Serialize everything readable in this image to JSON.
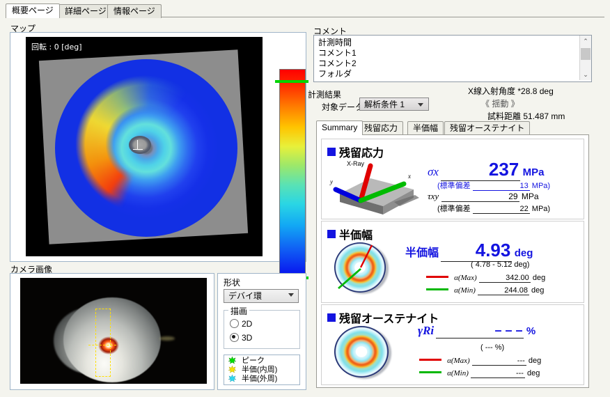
{
  "window": {
    "bg": "#f4f4ee"
  },
  "tabs": [
    {
      "label": "概要ページ",
      "selected": true
    },
    {
      "label": "詳細ページ",
      "selected": false
    },
    {
      "label": "情報ページ",
      "selected": false
    }
  ],
  "map": {
    "group_label": "マップ",
    "rotation_text": "回転 : 0 [deg]",
    "colorbar": {
      "top_color": "#ff0000",
      "bottom_color": "#0000ee",
      "marker_color": "#00d400"
    }
  },
  "camera": {
    "group_label": "カメラ画像",
    "selection_color": "#ffe000"
  },
  "shape": {
    "group_label": "形状",
    "selected_shape": "デバイ環",
    "draw_legend": "描画",
    "draw_options": [
      {
        "label": "2D",
        "selected": false
      },
      {
        "label": "3D",
        "selected": true
      }
    ],
    "legend": [
      {
        "label": "ピーク",
        "color": "#00e000"
      },
      {
        "label": "半価(内周)",
        "color": "#f5e400"
      },
      {
        "label": "半価(外周)",
        "color": "#30d8f0"
      }
    ]
  },
  "comment": {
    "group_label": "コメント",
    "items": [
      "計測時間",
      "コメント1",
      "コメント2",
      "フォルダ"
    ],
    "scroll_up": "⌃",
    "scroll_down": "⌄"
  },
  "measurement": {
    "group_label": "計測結果",
    "target_data_label": "対象データ",
    "target_data_value": "解析条件 1",
    "xray_angle_label": "X線入射角度",
    "xray_angle_value": "*28.8 deg",
    "swing_label": "《 揺動 》",
    "distance_label": "試料距離",
    "distance_value": "51.487 mm"
  },
  "result_tabs": [
    {
      "label": "Summary",
      "selected": true
    },
    {
      "label": "残留応力",
      "selected": false
    },
    {
      "label": "半価幅",
      "selected": false
    },
    {
      "label": "残留オーステナイト",
      "selected": false
    }
  ],
  "stress_card": {
    "title": "残留応力",
    "sketch_labels": {
      "xray": "X-Ray",
      "x_axis": "x",
      "y_axis": "y"
    },
    "sigma_symbol": "σx",
    "sigma_value": "237",
    "sigma_unit": "MPa",
    "sigma_sd_label": "(標準偏差",
    "sigma_sd_value": "13",
    "sigma_sd_unit": "MPa)",
    "tau_symbol": "τxy",
    "tau_value": "29",
    "tau_unit": "MPa",
    "tau_sd_label": "(標準偏差",
    "tau_sd_value": "22",
    "tau_sd_unit": "MPa)"
  },
  "fwhm_card": {
    "title": "半価幅",
    "value_label": "半価幅",
    "value": "4.93",
    "unit": "deg",
    "range_text": "( 4.78 - 5.12 deg)",
    "alpha_max_label": "α(Max)",
    "alpha_max_value": "342.00",
    "alpha_max_unit": "deg",
    "alpha_max_color": "#e00000",
    "alpha_min_label": "α(Min)",
    "alpha_min_value": "244.08",
    "alpha_min_unit": "deg",
    "alpha_min_color": "#00b800"
  },
  "austenite_card": {
    "title": "残留オーステナイト",
    "gamma_symbol": "γRi",
    "gamma_value": "– – –",
    "gamma_unit": "%",
    "range_text": "( --- %)",
    "alpha_max_label": "α(Max)",
    "alpha_max_value": "---",
    "alpha_max_unit": "deg",
    "alpha_max_color": "#e00000",
    "alpha_min_label": "α(Min)",
    "alpha_min_value": "---",
    "alpha_min_unit": "deg",
    "alpha_min_color": "#00b800"
  }
}
